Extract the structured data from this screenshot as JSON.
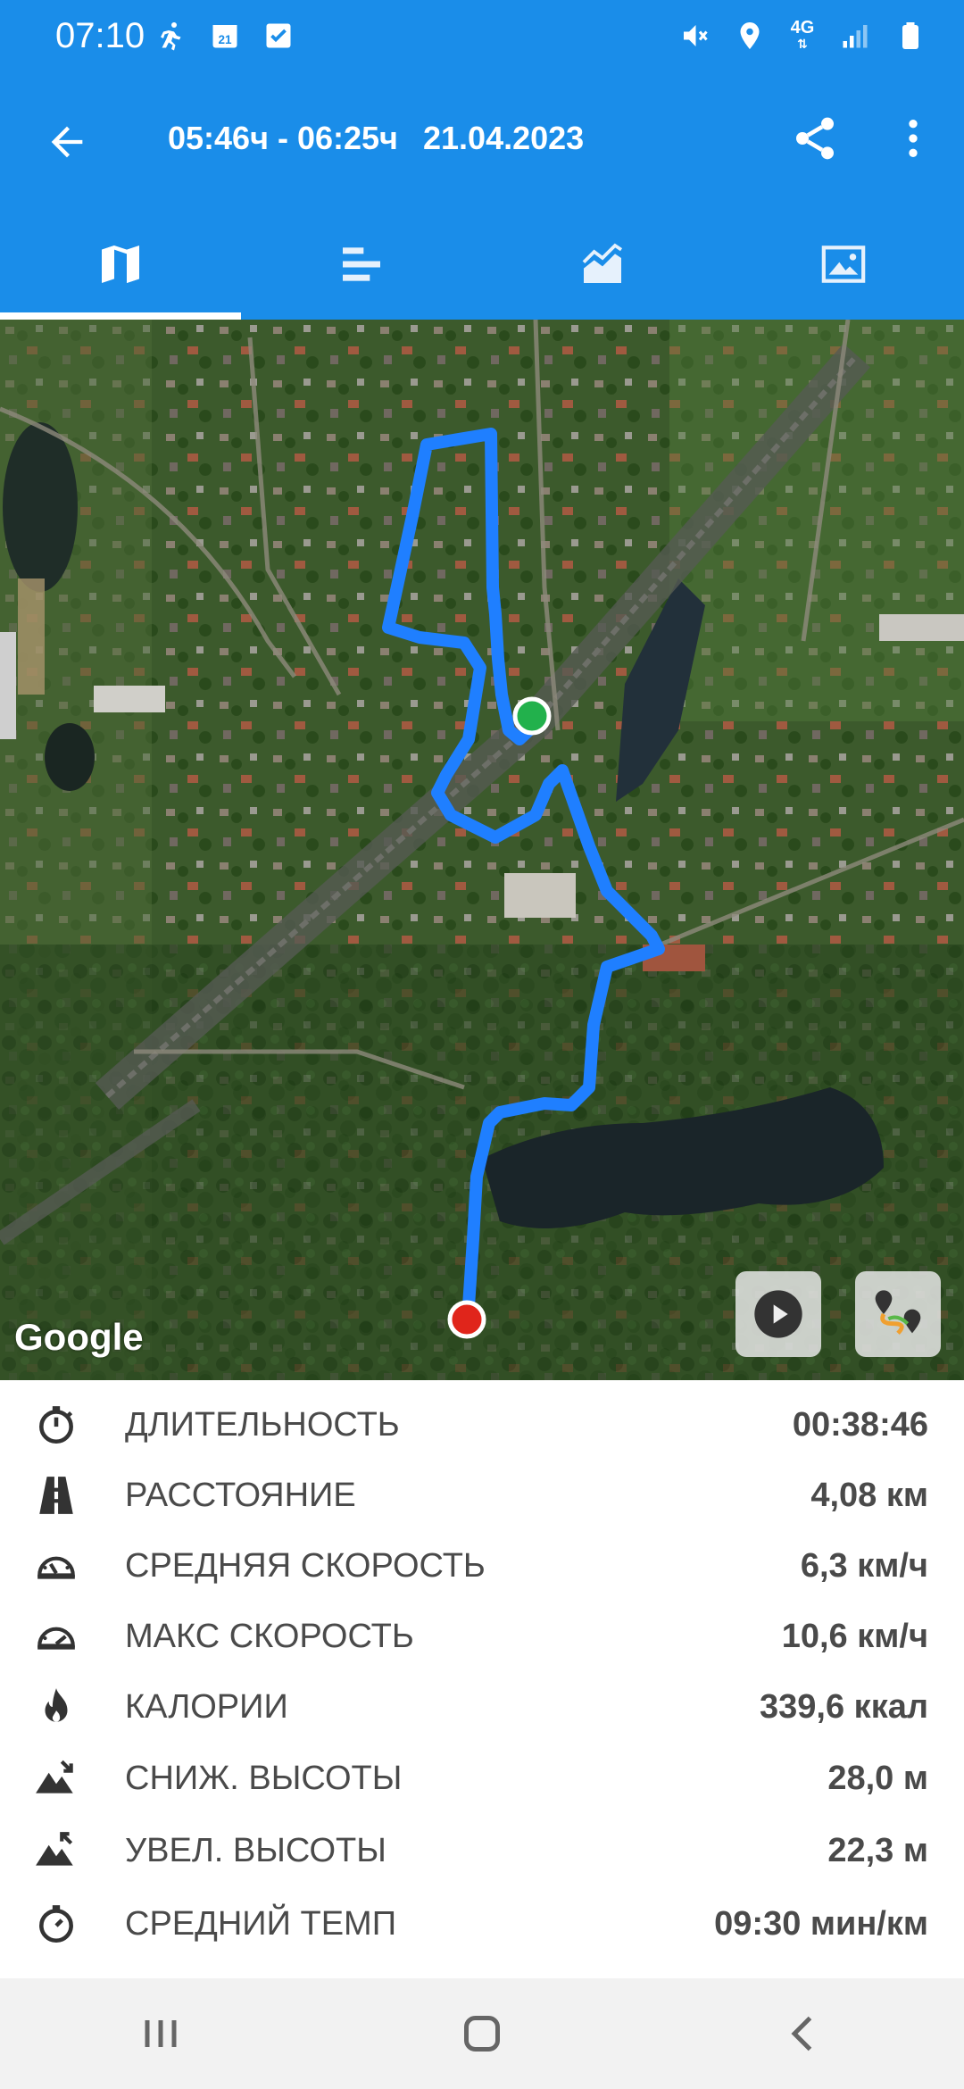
{
  "status_bar": {
    "time": "07:10",
    "network": "4G",
    "left_icons": [
      "running-icon",
      "calendar-icon",
      "checkbox-icon"
    ],
    "right_icons": [
      "mute-icon",
      "location-icon",
      "signal-icon",
      "battery-icon"
    ],
    "calendar_day": "21"
  },
  "app_bar": {
    "time_range": "05:46ч - 06:25ч",
    "date": "21.04.2023",
    "color": "#1a8de9"
  },
  "tabs": [
    {
      "name": "map",
      "icon": "map-icon",
      "active": true
    },
    {
      "name": "stats",
      "icon": "bar-list-icon",
      "active": false
    },
    {
      "name": "charts",
      "icon": "area-chart-icon",
      "active": false
    },
    {
      "name": "photos",
      "icon": "image-icon",
      "active": false
    }
  ],
  "map": {
    "attribution": "Google",
    "route_color": "#1f7fff",
    "start_color": "#22b14c",
    "end_color": "#e0251b"
  },
  "stats": [
    {
      "icon": "stopwatch-icon",
      "label": "ДЛИТЕЛЬНОСТЬ",
      "value": "00:38:46"
    },
    {
      "icon": "road-icon",
      "label": "РАССТОЯНИЕ",
      "value": "4,08 км"
    },
    {
      "icon": "speedometer-icon",
      "label": "СРЕДНЯЯ СКОРОСТЬ",
      "value": "6,3 км/ч"
    },
    {
      "icon": "speedometer-max-icon",
      "label": "МАКС СКОРОСТЬ",
      "value": "10,6 км/ч"
    },
    {
      "icon": "flame-icon",
      "label": "КАЛОРИИ",
      "value": "339,6 ккал"
    },
    {
      "icon": "mountain-down-icon",
      "label": "СНИЖ. ВЫСОТЫ",
      "value": "28,0 м"
    },
    {
      "icon": "mountain-up-icon",
      "label": "УВЕЛ. ВЫСОТЫ",
      "value": "22,3 м"
    },
    {
      "icon": "timer-icon",
      "label": "СРЕДНИЙ ТЕМП",
      "value": "09:30 мин/км"
    }
  ]
}
